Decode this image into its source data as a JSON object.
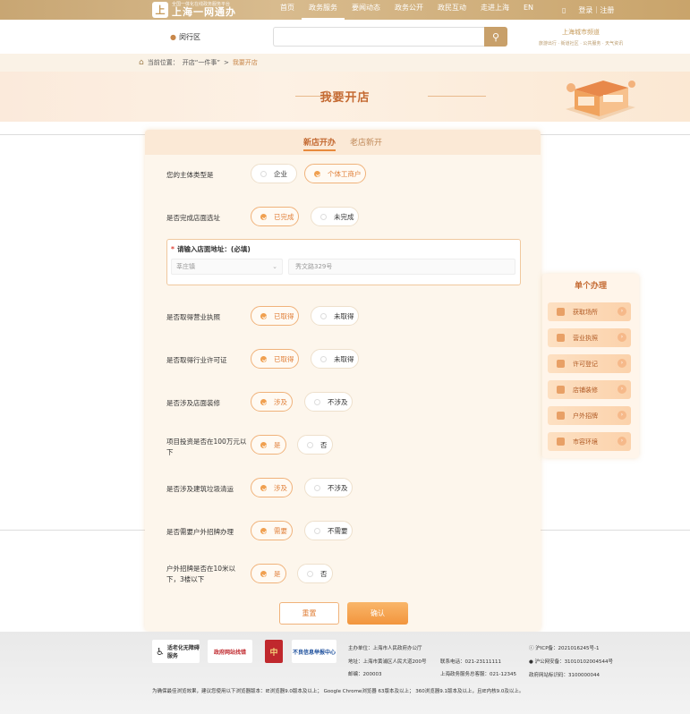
{
  "header": {
    "logo_mark": "上",
    "logo_sub": "全国一体化在线政务服务平台",
    "logo_main": "上海一网通办",
    "nav": [
      "首页",
      "政务服务",
      "要闻动态",
      "政务公开",
      "政民互动",
      "走进上海",
      "EN"
    ],
    "nav_active_index": 1,
    "login": "登录｜注册"
  },
  "search": {
    "district": "闵行区",
    "placeholder": "",
    "city_title": "上海城市频道",
    "city_sub": "旅游出行 · 街道社区 · 公共服务 · 天气资讯"
  },
  "breadcrumb": {
    "prefix": "当前位置：",
    "level1": "开店“一件事”",
    "sep": ">",
    "current": "我要开店"
  },
  "banner": {
    "title": "我要开店"
  },
  "tabs": [
    {
      "label": "新店开办",
      "active": true
    },
    {
      "label": "老店新开",
      "active": false
    }
  ],
  "questions": [
    {
      "q": "您的主体类型是",
      "options": [
        "企业",
        "个体工商户"
      ],
      "selected": 1
    },
    {
      "q": "是否完成店面选址",
      "options": [
        "已完成",
        "未完成"
      ],
      "selected": 0
    },
    {
      "q": "是否取得营业执照",
      "options": [
        "已取得",
        "未取得"
      ],
      "selected": 0
    },
    {
      "q": "是否取得行业许可证",
      "options": [
        "已取得",
        "未取得"
      ],
      "selected": 0
    },
    {
      "q": "是否涉及店面装修",
      "options": [
        "涉及",
        "不涉及"
      ],
      "selected": 0
    },
    {
      "q": "项目投资是否在100万元以下",
      "options": [
        "是",
        "否"
      ],
      "selected": 0
    },
    {
      "q": "是否涉及建筑垃圾清运",
      "options": [
        "涉及",
        "不涉及"
      ],
      "selected": 0
    },
    {
      "q": "是否需要户外招牌办理",
      "options": [
        "需要",
        "不需要"
      ],
      "selected": 0
    },
    {
      "q": "户外招牌是否在10米以下，3楼以下",
      "options": [
        "是",
        "否"
      ],
      "selected": 0
    }
  ],
  "address": {
    "label": "请输入店面地址：(必填)",
    "required_mark": "*",
    "town": "莘庄镇",
    "street": "秀文路329号"
  },
  "buttons": {
    "reset": "重置",
    "confirm": "确认"
  },
  "side_panel": {
    "title": "单个办理",
    "items": [
      "获取场所",
      "营业执照",
      "许可登记",
      "店铺装修",
      "户外招牌",
      "市容环境"
    ]
  },
  "footer": {
    "logos": [
      "适老化无障碍服务",
      "政府网站找错",
      "中",
      "不良信息举报中心"
    ],
    "sponsor": "主办单位：上海市人民政府办公厅",
    "address": "地址：上海市黄浦区人民大道200号",
    "postcode": "邮编：200003",
    "phone": "联系电话：021-23111111",
    "service_phone": "上海政务服务总客服：021-12345",
    "icp": "沪ICP备：2021016245号-1",
    "police": "沪公网安备：31010102004544号",
    "site_code": "政府网站标识码：3100000044",
    "browser_note": "为确保最佳浏览效果，建议您使用以下浏览器版本：IE浏览器9.0版本及以上； Google Chrome浏览器 63版本及以上； 360浏览器9.1版本及以上，且IE内核9.0及以上。"
  },
  "colors": {
    "brand": "#c8a06a",
    "accent": "#e0803a",
    "title": "#c46a32"
  }
}
